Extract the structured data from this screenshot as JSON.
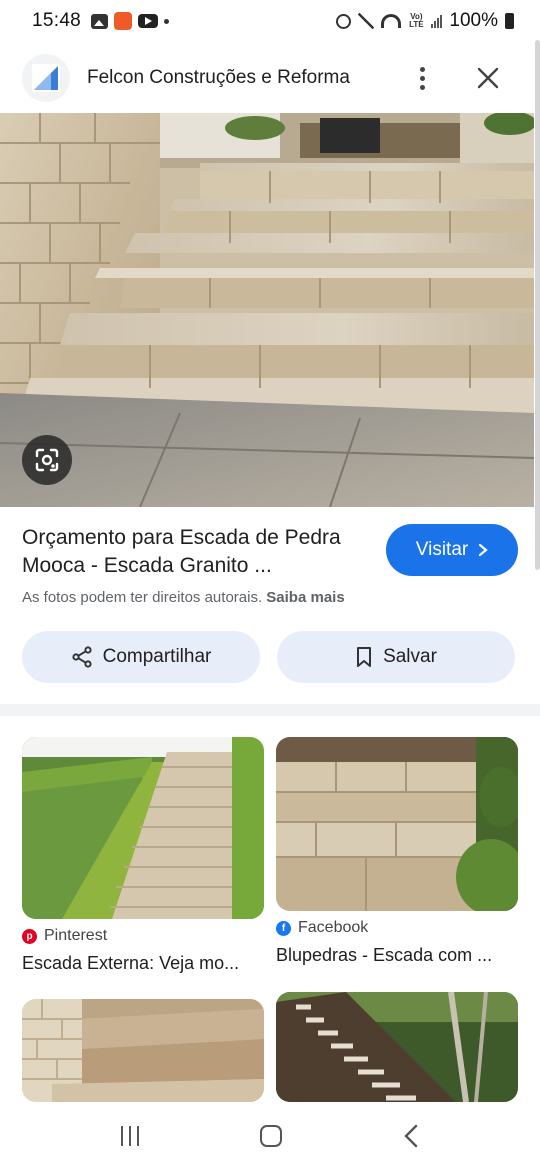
{
  "status_bar": {
    "time": "15:48",
    "battery": "100%",
    "lte_label": "Vo) LTE"
  },
  "header": {
    "site_name": "Felcon Construções e Reforma",
    "logo_icon": "felcon-logo",
    "more_icon": "more-vert-icon",
    "close_icon": "close-icon"
  },
  "result": {
    "title": "Orçamento para Escada de Pedra Mooca - Escada Granito ...",
    "visit_label": "Visitar",
    "copyright_text": "As fotos podem ter direitos autorais.",
    "learn_more": "Saiba mais",
    "share_label": "Compartilhar",
    "save_label": "Salvar"
  },
  "related": [
    {
      "source": "Pinterest",
      "source_icon": "pinterest-icon",
      "source_color": "#e60023",
      "title": "Escada Externa: Veja mo..."
    },
    {
      "source": "Facebook",
      "source_icon": "facebook-icon",
      "source_color": "#1877f2",
      "title": "Blupedras - Escada com ..."
    }
  ],
  "colors": {
    "accent": "#1a73e8",
    "chip_background": "#e8eef9"
  }
}
